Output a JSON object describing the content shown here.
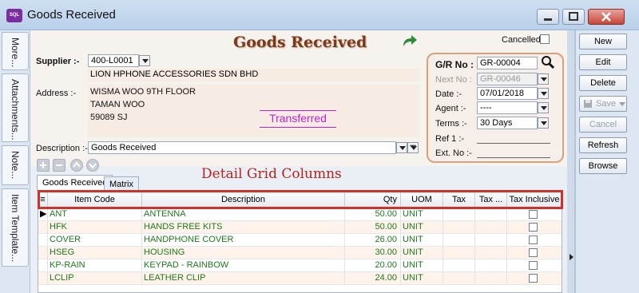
{
  "window": {
    "title": "Goods Received",
    "app_icon_text": "SQL"
  },
  "side_tabs": [
    "More...",
    "Attachments...",
    "Note...",
    "Item Template..."
  ],
  "form": {
    "title": "Goods Received",
    "cancelled_label": "Cancelled",
    "supplier_label": "Supplier :-",
    "supplier_code": "400-L0001",
    "supplier_name": "LION HPHONE ACCESSORIES SDN BHD",
    "address_label": "Address :-",
    "address_lines": [
      "WISMA WOO 9TH FLOOR",
      "TAMAN WOO",
      "59089 SJ"
    ],
    "status_stamp": "Transferred",
    "description_label": "Description :-",
    "description_value": "Goods Received",
    "gr_no_label": "G/R No :",
    "gr_no_value": "GR-00004",
    "next_no_label": "Next No :",
    "next_no_value": "GR-00046",
    "date_label": "Date :-",
    "date_value": "07/01/2018",
    "agent_label": "Agent :-",
    "agent_value": "----",
    "terms_label": "Terms :-",
    "terms_value": "30 Days",
    "ref1_label": "Ref 1 :-",
    "extno_label": "Ext. No :-",
    "more_button": "•••"
  },
  "buttons": [
    "New",
    "Edit",
    "Delete",
    "Save",
    "Cancel",
    "Refresh",
    "Browse"
  ],
  "tabs": [
    "Goods Received",
    "Matrix"
  ],
  "annotation": "Detail Grid Columns",
  "grid": {
    "columns": [
      "Item Code",
      "Description",
      "Qty",
      "UOM",
      "Tax",
      "Tax ...",
      "Tax Inclusive"
    ],
    "rows": [
      {
        "code": "ANT",
        "desc": "ANTENNA",
        "qty": "50.00",
        "uom": "UNIT"
      },
      {
        "code": "HFK",
        "desc": "HANDS FREE KITS",
        "qty": "50.00",
        "uom": "UNIT"
      },
      {
        "code": "COVER",
        "desc": "HANDPHONE COVER",
        "qty": "26.00",
        "uom": "UNIT"
      },
      {
        "code": "HSEG",
        "desc": "HOUSING",
        "qty": "30.00",
        "uom": "UNIT"
      },
      {
        "code": "KP-RAIN",
        "desc": "KEYPAD - RAINBOW",
        "qty": "20.00",
        "uom": "UNIT"
      },
      {
        "code": "LCLIP",
        "desc": "LEATHER CLIP",
        "qty": "24.00",
        "uom": "UNIT"
      }
    ]
  }
}
